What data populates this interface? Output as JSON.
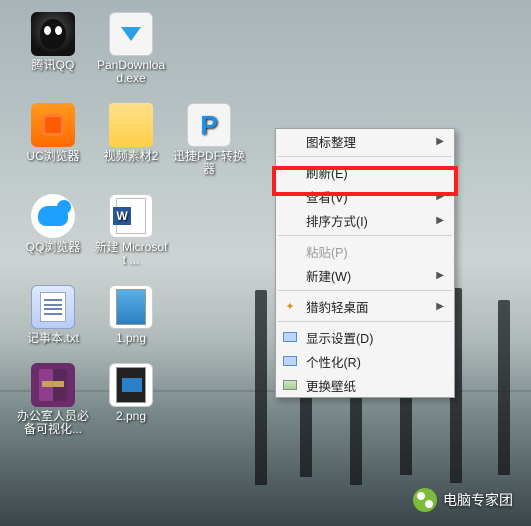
{
  "desktop": {
    "rows": [
      [
        {
          "name": "qq-icon",
          "label": "腾讯QQ",
          "type": "qq"
        },
        {
          "name": "pandownload-icon",
          "label": "PanDownload.exe",
          "type": "pan"
        }
      ],
      [
        {
          "name": "uc-browser-icon",
          "label": "UC浏览器",
          "type": "uc"
        },
        {
          "name": "video-folder-icon",
          "label": "视频素材2",
          "type": "folder"
        },
        {
          "name": "pdf-converter-icon",
          "label": "迅捷PDF转换器",
          "type": "pdf"
        }
      ],
      [
        {
          "name": "qq-browser-icon",
          "label": "QQ浏览器",
          "type": "qqb"
        },
        {
          "name": "word-doc-icon",
          "label": "新建 Microsoft ...",
          "type": "word"
        }
      ],
      [
        {
          "name": "notepad-file-icon",
          "label": "记事本.txt",
          "type": "txt"
        },
        {
          "name": "png1-icon",
          "label": "1.png",
          "type": "png"
        }
      ],
      [
        {
          "name": "rar-file-icon",
          "label": "办公室人员必备可视化...",
          "type": "rar"
        },
        {
          "name": "png2-icon",
          "label": "2.png",
          "type": "png2"
        }
      ]
    ]
  },
  "menu": {
    "items": [
      {
        "name": "menu-icon-arrange",
        "label": "图标整理",
        "submenu": true
      },
      {
        "sep": true
      },
      {
        "name": "menu-refresh",
        "label": "刷新(E)",
        "highlighted": true
      },
      {
        "name": "menu-view",
        "label": "查看(V)",
        "submenu": true
      },
      {
        "name": "menu-sort",
        "label": "排序方式(I)",
        "submenu": true
      },
      {
        "sep": true
      },
      {
        "name": "menu-paste",
        "label": "粘贴(P)",
        "disabled": true
      },
      {
        "name": "menu-new",
        "label": "新建(W)",
        "submenu": true
      },
      {
        "sep": true
      },
      {
        "name": "menu-liebao",
        "label": "猎豹轻桌面",
        "icon": "paw",
        "submenu": true
      },
      {
        "sep": true
      },
      {
        "name": "menu-display",
        "label": "显示设置(D)",
        "icon": "disp"
      },
      {
        "name": "menu-personalize",
        "label": "个性化(R)",
        "icon": "pers"
      },
      {
        "name": "menu-wallpaper",
        "label": "更换壁纸",
        "icon": "wall"
      }
    ]
  },
  "watermark": {
    "label": "电脑专家团"
  }
}
